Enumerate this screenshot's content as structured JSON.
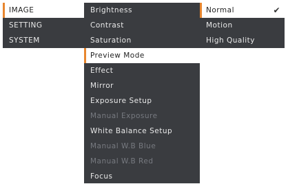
{
  "main_menu": {
    "items": [
      {
        "label": "IMAGE",
        "selected": true
      },
      {
        "label": "SETTING",
        "selected": false
      },
      {
        "label": "SYSTEM",
        "selected": false
      }
    ]
  },
  "image_menu": {
    "items": [
      {
        "label": "Brightness",
        "enabled": true
      },
      {
        "label": "Contrast",
        "enabled": true
      },
      {
        "label": "Saturation",
        "enabled": true
      },
      {
        "label": "Preview Mode",
        "enabled": true,
        "selected": true
      },
      {
        "label": "Effect",
        "enabled": true
      },
      {
        "label": "Mirror",
        "enabled": true
      },
      {
        "label": "Exposure Setup",
        "enabled": true
      },
      {
        "label": "Manual Exposure",
        "enabled": false
      },
      {
        "label": "White Balance Setup",
        "enabled": true
      },
      {
        "label": "Manual W.B Blue",
        "enabled": false
      },
      {
        "label": "Manual W.B Red",
        "enabled": false
      },
      {
        "label": "Focus",
        "enabled": true
      }
    ]
  },
  "preview_mode_menu": {
    "items": [
      {
        "label": "Normal",
        "checked": true
      },
      {
        "label": "Motion",
        "checked": false
      },
      {
        "label": "High Quality",
        "checked": false
      }
    ],
    "check_icon": "✔"
  },
  "colors": {
    "panel_bg": "#3a3c40",
    "text": "#e9e9e9",
    "disabled_text": "#777a80",
    "selected_bg": "#ffffff",
    "accent": "#e8862e"
  }
}
